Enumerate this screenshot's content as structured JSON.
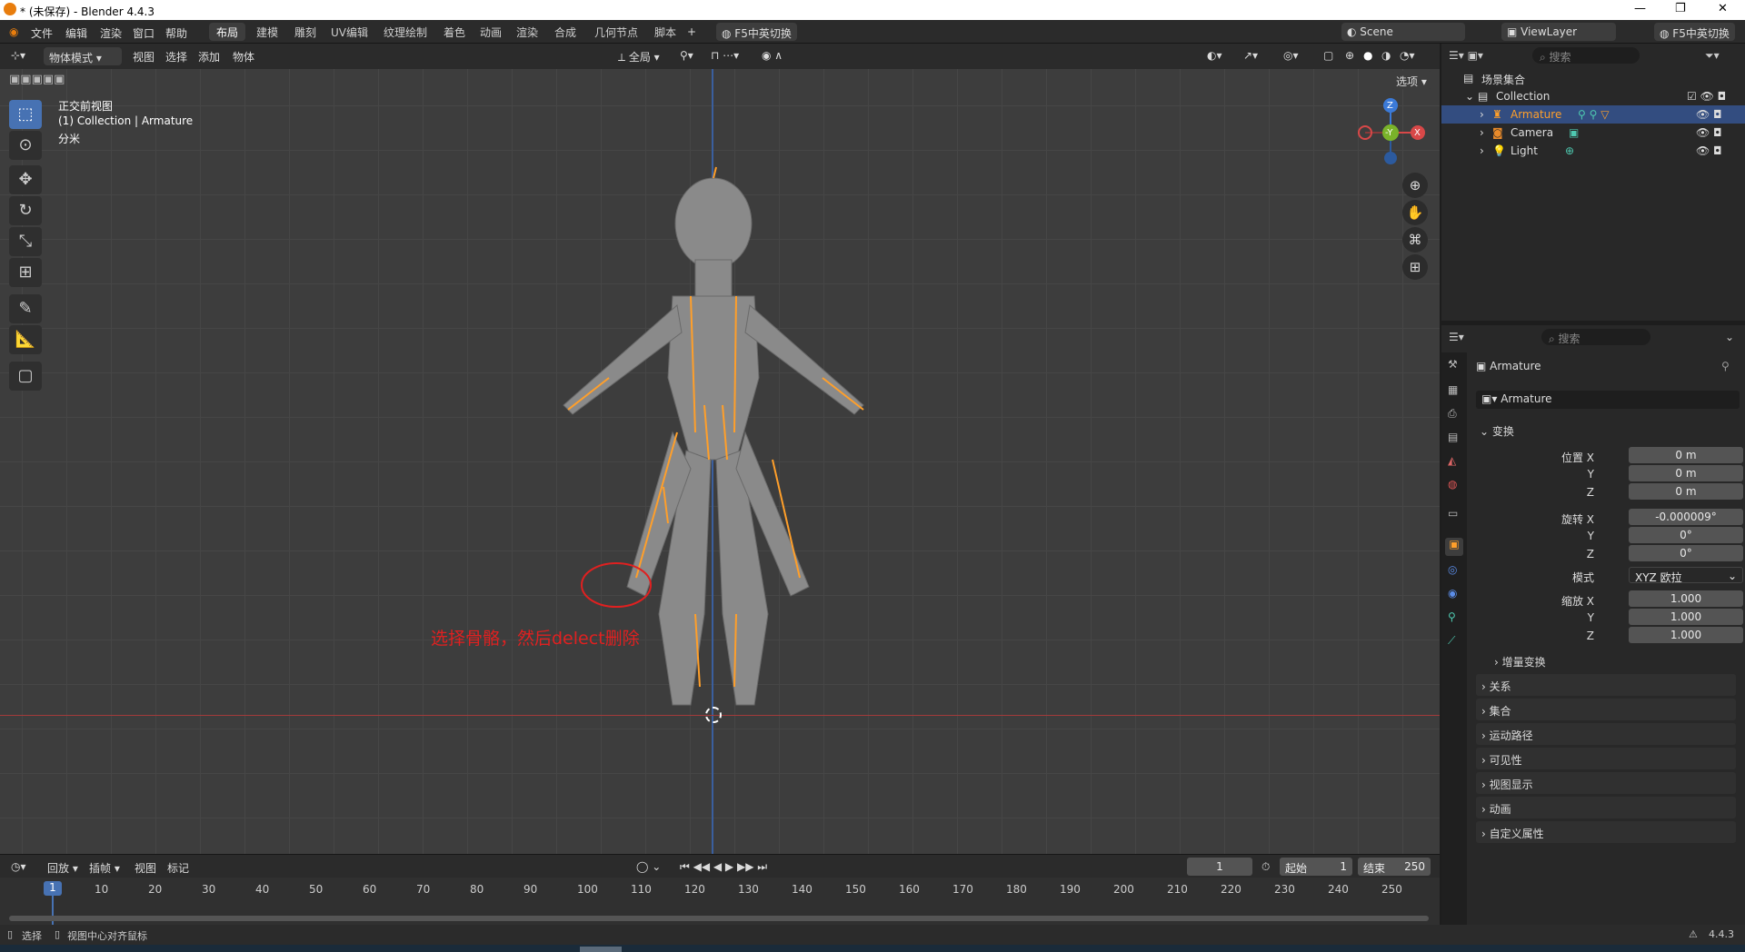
{
  "window": {
    "title": "* (未保存) - Blender 4.4.3"
  },
  "menu": [
    "文件",
    "编辑",
    "渲染",
    "窗口",
    "帮助"
  ],
  "workspaces": [
    "布局",
    "建模",
    "雕刻",
    "UV编辑",
    "纹理绘制",
    "着色",
    "动画",
    "渲染",
    "合成",
    "几何节点",
    "脚本"
  ],
  "lang_btn": "F5中英切换",
  "scene": "Scene",
  "viewlayer": "ViewLayer",
  "viewport_header": {
    "mode": "物体模式",
    "menus": [
      "视图",
      "选择",
      "添加",
      "物体"
    ],
    "orientation": "全局",
    "options": "选项"
  },
  "overlay": {
    "view": "正交前视图",
    "collection": "(1) Collection | Armature",
    "unit": "分米"
  },
  "annotation": "选择骨骼，然后delect删除",
  "gizmo": {
    "z": "Z",
    "y": "-Y",
    "x": "X"
  },
  "outliner": {
    "search": "搜索",
    "scene_collection": "场景集合",
    "collection": "Collection",
    "items": [
      "Armature",
      "Camera",
      "Light"
    ]
  },
  "props": {
    "search": "搜索",
    "object_name": "Armature",
    "data_name": "Armature",
    "transform": "变换",
    "location_label": "位置 X",
    "rotation_label": "旋转 X",
    "scale_label": "缩放 X",
    "y": "Y",
    "z": "Z",
    "loc": [
      "0 m",
      "0 m",
      "0 m"
    ],
    "rot": [
      "-0.000009°",
      "0°",
      "0°"
    ],
    "mode_label": "模式",
    "mode_value": "XYZ 欧拉",
    "scale": [
      "1.000",
      "1.000",
      "1.000"
    ],
    "delta": "增量变换",
    "panels": [
      "关系",
      "集合",
      "运动路径",
      "可见性",
      "视图显示",
      "动画",
      "自定义属性"
    ]
  },
  "timeline": {
    "menus": [
      "回放",
      "插帧",
      "视图",
      "标记"
    ],
    "current": "1",
    "start_label": "起始",
    "start": "1",
    "end_label": "结束",
    "end": "250",
    "current_marker": "1",
    "frames": [
      "10",
      "20",
      "30",
      "40",
      "50",
      "60",
      "70",
      "80",
      "90",
      "100",
      "110",
      "120",
      "130",
      "140",
      "150",
      "160",
      "170",
      "180",
      "190",
      "200",
      "210",
      "220",
      "230",
      "240",
      "250"
    ]
  },
  "status": {
    "left1": "选择",
    "left2": "视图中心对齐鼠标",
    "version": "4.4.3"
  }
}
